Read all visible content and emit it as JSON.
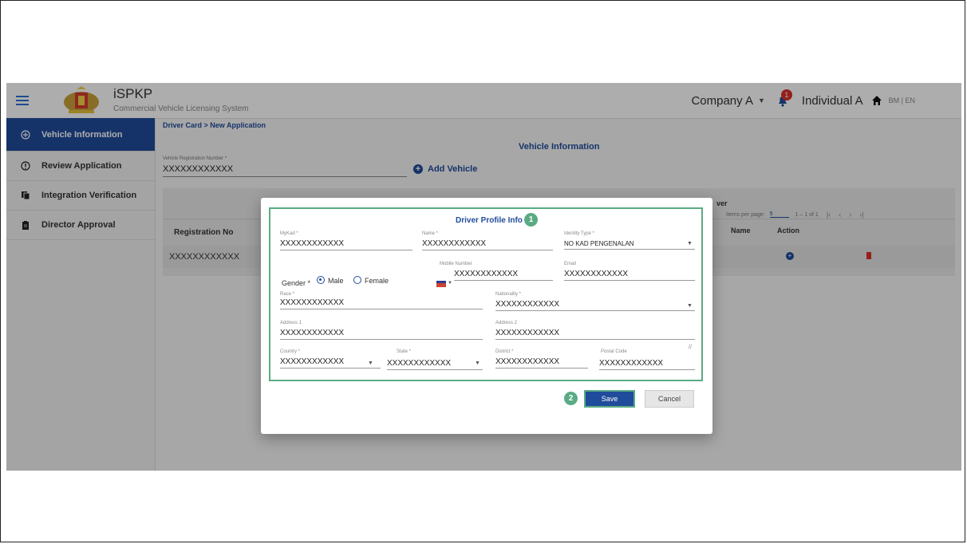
{
  "header": {
    "brand": "iSPKP",
    "brand_sub": "Commercial Vehicle Licensing System",
    "company": "Company A",
    "notification_count": "1",
    "individual": "Individual A",
    "lang": "BM  |  EN"
  },
  "sidebar": {
    "items": [
      {
        "label": "Vehicle Information",
        "icon": "add-circle-icon"
      },
      {
        "label": "Review Application",
        "icon": "alert-circle-icon"
      },
      {
        "label": "Integration Verification",
        "icon": "copy-icon"
      },
      {
        "label": "Director Approval",
        "icon": "clipboard-icon"
      }
    ]
  },
  "main": {
    "breadcrumb": "Driver Card > New Application",
    "section_title": "Vehicle Information",
    "vehicle_reg_label": "Vehicle Registration Number *",
    "vehicle_reg_value": "XXXXXXXXXXXX",
    "add_vehicle_label": "Add Vehicle",
    "table": {
      "driver_header_partial": "ver",
      "col_registration": "Registration No",
      "col_name": "Name",
      "col_action": "Action",
      "row_registration": "XXXXXXXXXXXX"
    },
    "pager": {
      "items_per_page_label": "Items per page:",
      "items_per_page_value": "5",
      "range": "1 – 1 of 1"
    }
  },
  "modal": {
    "title": "Driver Profile Info",
    "step1": "1",
    "step2": "2",
    "mykad_label": "MyKad *",
    "mykad_value": "XXXXXXXXXXXX",
    "name_label": "Name *",
    "name_value": "XXXXXXXXXXXX",
    "identity_label": "Identity Type *",
    "identity_value": "NO KAD PENGENALAN",
    "gender_label": "Gender *",
    "gender_male": "Male",
    "gender_female": "Female",
    "mobile_label": "Mobile Number",
    "mobile_value": "XXXXXXXXXXXX",
    "email_label": "Email",
    "email_value": "XXXXXXXXXXXX",
    "race_label": "Race *",
    "race_value": "XXXXXXXXXXXX",
    "nationality_label": "Nationality *",
    "nationality_value": "XXXXXXXXXXXX",
    "address1_label": "Address 1",
    "address1_value": "XXXXXXXXXXXX",
    "address2_label": "Address 2",
    "address2_value": "XXXXXXXXXXXX",
    "country_label": "Country *",
    "country_value": "XXXXXXXXXXXX",
    "state_label": "State *",
    "state_value": "XXXXXXXXXXXX",
    "district_label": "District *",
    "district_value": "XXXXXXXXXXXX",
    "postal_label": "Postal Code",
    "postal_value": "XXXXXXXXXXXX",
    "save_label": "Save",
    "cancel_label": "Cancel"
  },
  "colors": {
    "primary": "#1f4c9b",
    "highlight": "#5aab84",
    "danger": "#d9302c"
  }
}
